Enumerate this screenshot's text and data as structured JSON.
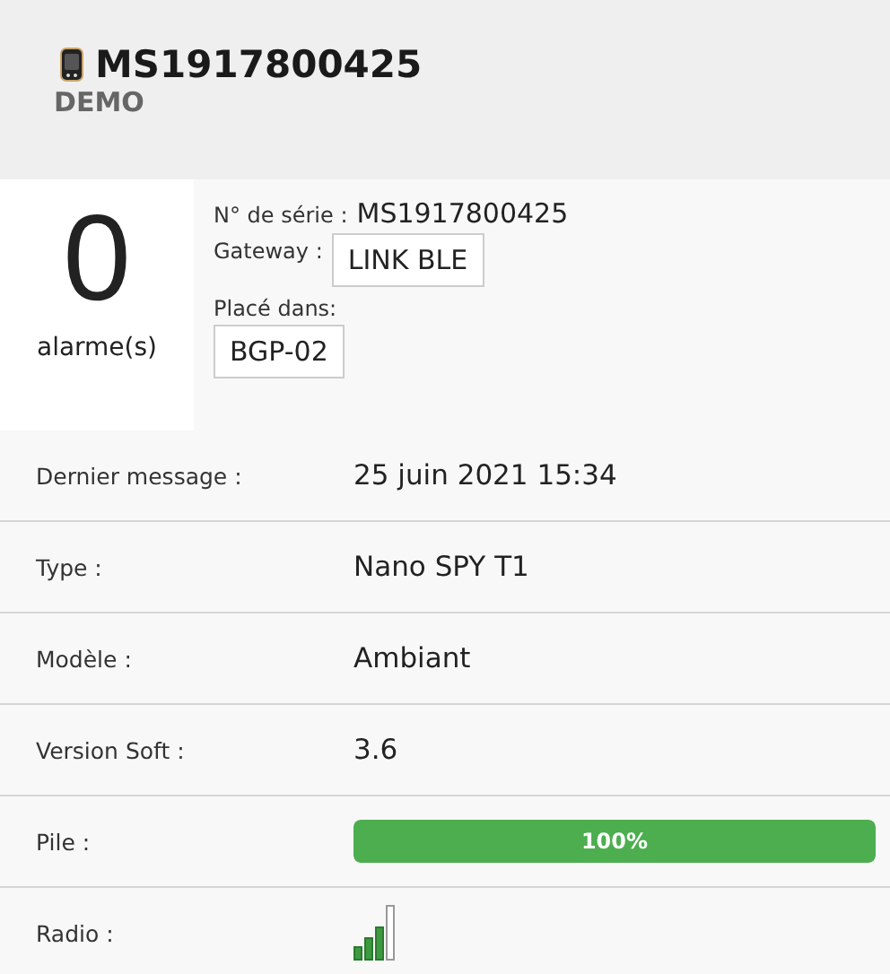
{
  "header": {
    "title": "MS1917800425",
    "subtitle": "DEMO"
  },
  "alarms": {
    "count": "0",
    "label": "alarme(s)"
  },
  "info": {
    "serial_label": "N° de série :",
    "serial_value": "MS1917800425",
    "gateway_label": "Gateway :",
    "gateway_value": "LINK BLE",
    "placed_label": "Placé dans:",
    "placed_value": "BGP-02"
  },
  "rows": [
    {
      "kind": "text",
      "label": "Dernier message :",
      "value": "25 juin 2021 15:34"
    },
    {
      "kind": "text",
      "label": "Type :",
      "value": "Nano SPY T1"
    },
    {
      "kind": "text",
      "label": "Modèle :",
      "value": "Ambiant"
    },
    {
      "kind": "text",
      "label": "Version Soft :",
      "value": "3.6"
    },
    {
      "kind": "battery",
      "label": "Pile :",
      "level": 1,
      "reading": "100%"
    },
    {
      "kind": "signal",
      "label": "Radio :"
    }
  ]
}
